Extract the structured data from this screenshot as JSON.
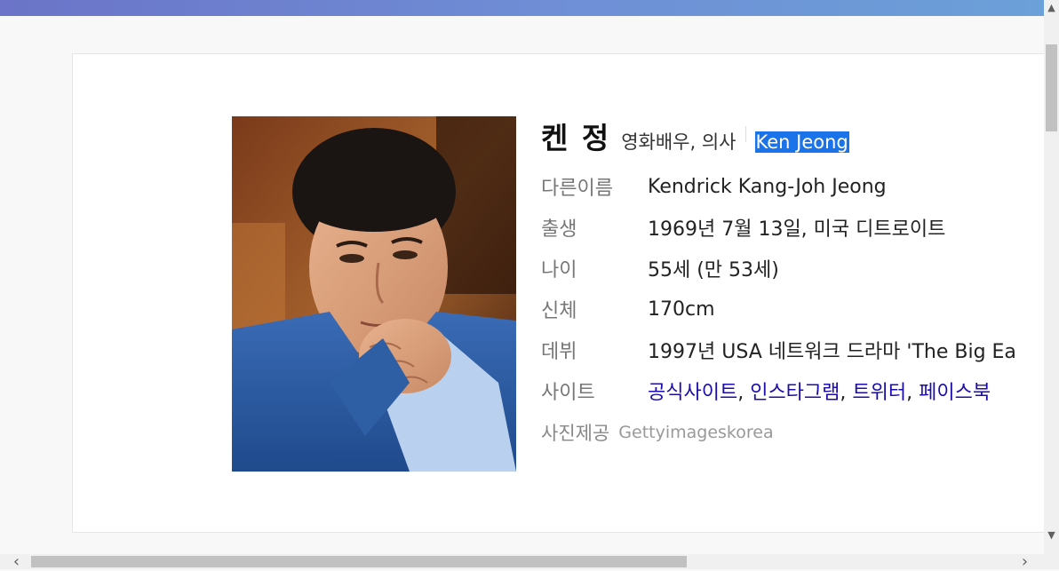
{
  "profile": {
    "name": "켄 정",
    "roles": "영화배우, 의사",
    "english_name": "Ken Jeong"
  },
  "rows": [
    {
      "label": "다른이름",
      "value": "Kendrick Kang-Joh Jeong"
    },
    {
      "label": "출생",
      "value": "1969년 7월 13일, 미국 디트로이트"
    },
    {
      "label": "나이",
      "value": "55세 (만 53세)"
    },
    {
      "label": "신체",
      "value": "170cm"
    },
    {
      "label": "데뷔",
      "value": "1997년 USA 네트워크 드라마 'The Big Ea"
    }
  ],
  "sites": {
    "label": "사이트",
    "links": [
      "공식사이트",
      "인스타그램",
      "트위터",
      "페이스북"
    ],
    "separator": ","
  },
  "credit": {
    "label": "사진제공",
    "value": "Gettyimageskorea"
  },
  "scrollbars": {
    "up_arrow": "▲",
    "down_arrow": "▼",
    "left_arrow": "‹",
    "right_arrow": "›"
  },
  "colors": {
    "highlight": "#1a73e8",
    "link": "#1a0dab",
    "top_gradient_start": "#6b74c8",
    "top_gradient_end": "#6ba0d8"
  }
}
